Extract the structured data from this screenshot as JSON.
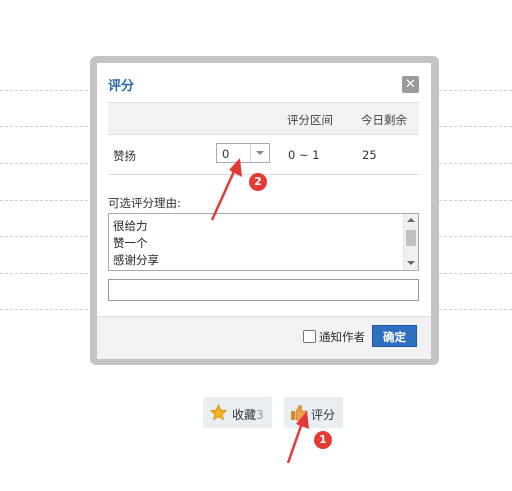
{
  "dialog": {
    "title": "评分",
    "close_symbol": "✕",
    "table": {
      "headers": [
        "",
        "",
        "评分区间",
        "今日剩余"
      ],
      "row": {
        "name": "赞扬",
        "score_value": "0",
        "range": "0 ~ 1",
        "remaining": "25"
      }
    },
    "reason_label": "可选评分理由:",
    "reasons": [
      "很给力",
      "赞一个",
      "感谢分享"
    ],
    "reason_input_value": "",
    "notify_author_label": "通知作者",
    "notify_author_checked": false,
    "confirm_label": "确定"
  },
  "actions": {
    "favorite_label": "收藏",
    "favorite_count": "3",
    "rate_label": "评分"
  },
  "annotations": {
    "step1": "1",
    "step2": "2"
  },
  "colors": {
    "title_blue": "#2b6aa8",
    "confirm_blue": "#2f6fbf",
    "annotation_red": "#e53935"
  }
}
